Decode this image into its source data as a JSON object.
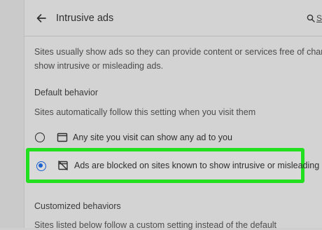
{
  "header": {
    "title": "Intrusive ads",
    "search_label": "Se"
  },
  "description": {
    "line1": "Sites usually show ads so they can provide content or services free of charge. But, so",
    "line2": "show intrusive or misleading ads."
  },
  "default_behavior": {
    "title": "Default behavior",
    "subtitle": "Sites automatically follow this setting when you visit them",
    "options": [
      {
        "label": "Any site you visit can show any ad to you",
        "selected": false,
        "icon": "window-icon"
      },
      {
        "label": "Ads are blocked on sites known to show intrusive or misleading ads",
        "selected": true,
        "icon": "ads-blocked-icon"
      }
    ]
  },
  "customized": {
    "title": "Customized behaviors",
    "subtitle": "Sites listed below follow a custom setting instead of the default"
  },
  "colors": {
    "highlight": "#22e01f",
    "radio_selected": "#1b5fd1"
  }
}
